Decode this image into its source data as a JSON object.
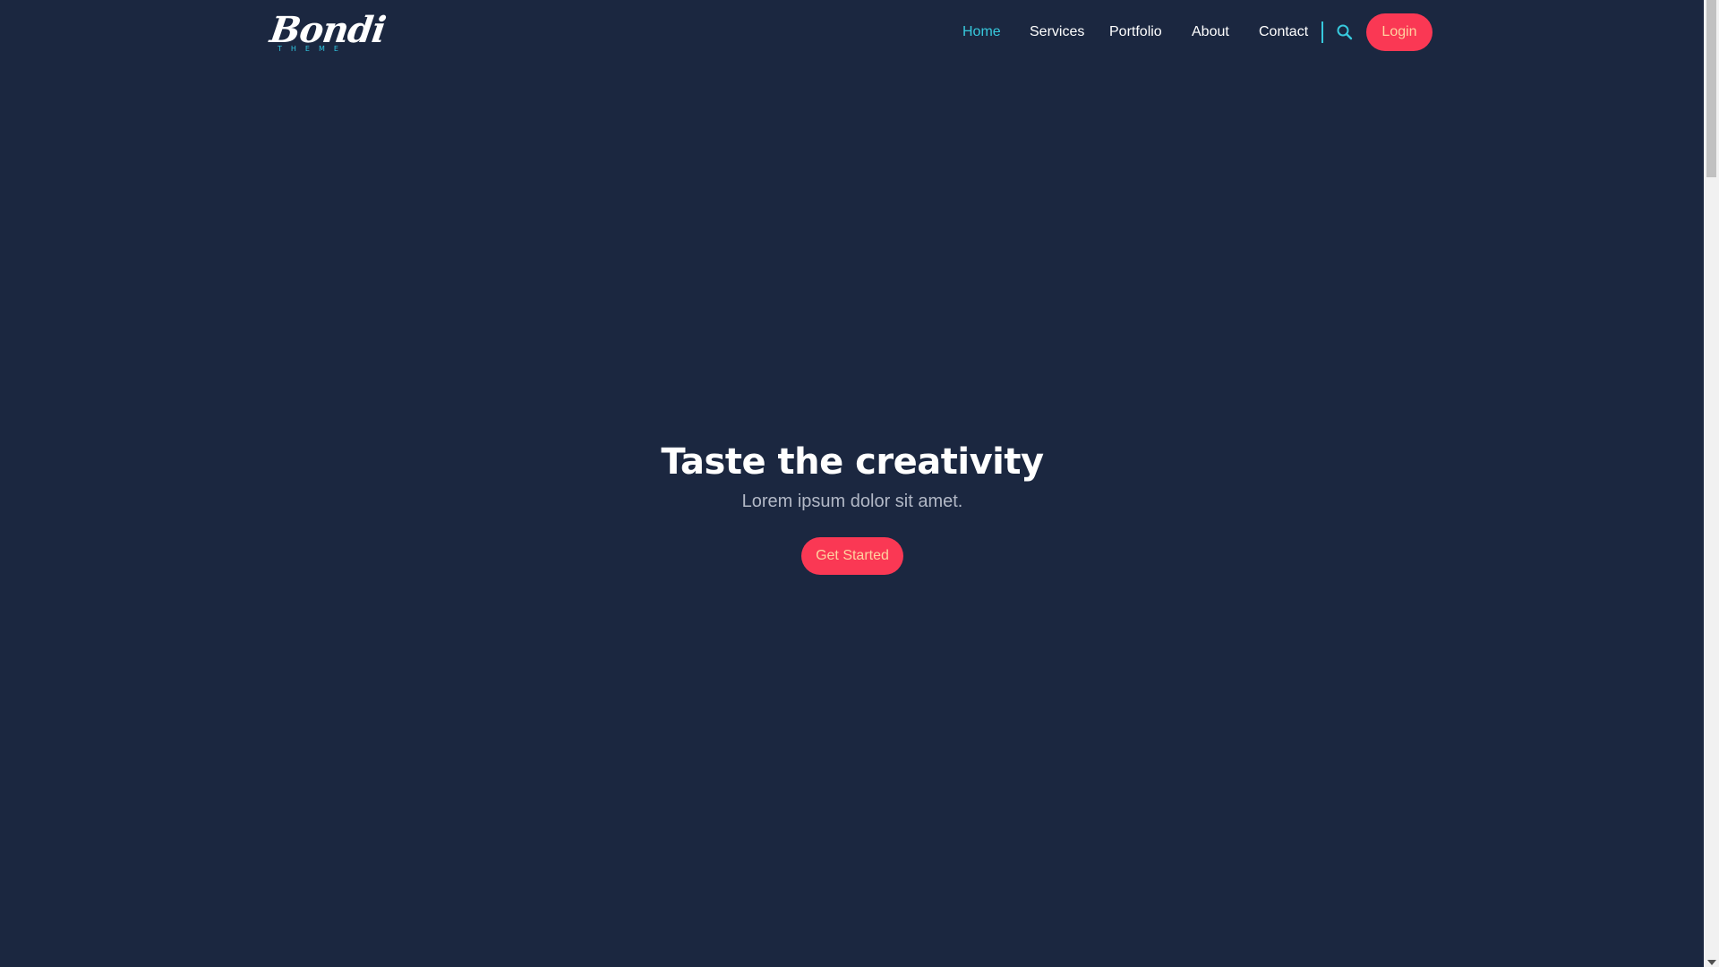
{
  "header": {
    "logo": {
      "word": "Bondi",
      "sub": "THEME"
    },
    "nav": [
      {
        "label": "Home",
        "active": true
      },
      {
        "label": "Services",
        "active": false
      },
      {
        "label": "Portfolio",
        "active": false
      },
      {
        "label": "About",
        "active": false
      },
      {
        "label": "Contact",
        "active": false
      }
    ],
    "search_icon": "search-icon",
    "login_label": "Login"
  },
  "hero": {
    "title": "Taste the creativity",
    "subtitle": "Lorem ipsum dolor sit amet.",
    "cta_label": "Get Started"
  },
  "colors": {
    "background": "#1b2740",
    "accent": "#37c9dd",
    "button": "#fa3854",
    "button_text": "#ffd2a0"
  }
}
